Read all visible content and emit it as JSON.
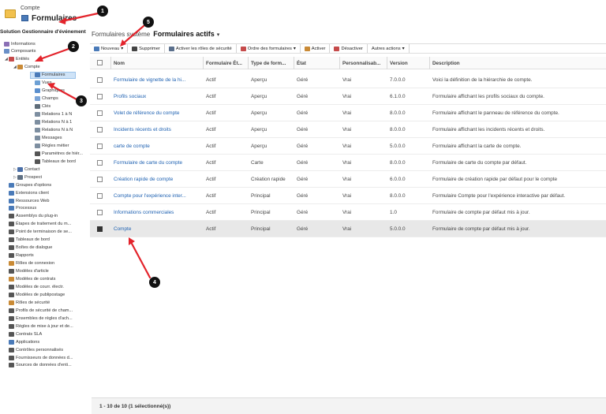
{
  "header": {
    "small_label": "Compte",
    "title": "Formulaires",
    "solution": "Solution Gestionnaire d'événement"
  },
  "tree": [
    {
      "label": "Informations",
      "icon": "puzzle-icon",
      "color": "#8a6fb5",
      "indent": 0,
      "toggle": ""
    },
    {
      "label": "Composants",
      "icon": "grid-icon",
      "color": "#6a8fc7",
      "indent": 0,
      "toggle": ""
    },
    {
      "label": "Entités",
      "icon": "table-icon",
      "color": "#c54a4a",
      "indent": 1,
      "toggle": "◢"
    },
    {
      "label": "Compte",
      "icon": "account-icon",
      "color": "#c98a36",
      "indent": 2,
      "toggle": "◢"
    },
    {
      "label": "Formulaires",
      "icon": "form-icon",
      "color": "#4a7ab8",
      "indent": 3,
      "toggle": "",
      "selected": true
    },
    {
      "label": "Vues",
      "icon": "view-icon",
      "color": "#6da0d4",
      "indent": 3,
      "toggle": ""
    },
    {
      "label": "Graphiques",
      "icon": "chart-icon",
      "color": "#5b8fce",
      "indent": 3,
      "toggle": ""
    },
    {
      "label": "Champs",
      "icon": "field-icon",
      "color": "#7aa3d6",
      "indent": 3,
      "toggle": ""
    },
    {
      "label": "Clés",
      "icon": "key-icon",
      "color": "#5f6d7a",
      "indent": 3,
      "toggle": ""
    },
    {
      "label": "Relations 1 à N",
      "icon": "relation-icon",
      "color": "#7d8ea0",
      "indent": 3,
      "toggle": ""
    },
    {
      "label": "Relations N à 1",
      "icon": "relation-icon",
      "color": "#7d8ea0",
      "indent": 3,
      "toggle": ""
    },
    {
      "label": "Relations N à N",
      "icon": "relation-icon",
      "color": "#7d8ea0",
      "indent": 3,
      "toggle": ""
    },
    {
      "label": "Messages",
      "icon": "message-icon",
      "color": "#7d8ea0",
      "indent": 3,
      "toggle": ""
    },
    {
      "label": "Règles métier",
      "icon": "rule-icon",
      "color": "#7d8ea0",
      "indent": 3,
      "toggle": ""
    },
    {
      "label": "Paramètres de hiér...",
      "icon": "hierarchy-icon",
      "color": "#555",
      "indent": 3,
      "toggle": ""
    },
    {
      "label": "Tableaux de bord",
      "icon": "dashboard-icon",
      "color": "#555",
      "indent": 3,
      "toggle": ""
    },
    {
      "label": "Contact",
      "icon": "contact-icon",
      "color": "#4a6fa8",
      "indent": 2,
      "toggle": "▷"
    },
    {
      "label": "Prospect",
      "icon": "prospect-icon",
      "color": "#5e6f82",
      "indent": 2,
      "toggle": "▷"
    },
    {
      "label": "Groupes d'options",
      "icon": "options-icon",
      "color": "#4a7ab8",
      "indent": 1,
      "toggle": ""
    },
    {
      "label": "Extensions client",
      "icon": "extension-icon",
      "color": "#4a7ab8",
      "indent": 1,
      "toggle": ""
    },
    {
      "label": "Ressources Web",
      "icon": "web-icon",
      "color": "#4a7ab8",
      "indent": 1,
      "toggle": ""
    },
    {
      "label": "Processus",
      "icon": "process-icon",
      "color": "#4a7ab8",
      "indent": 1,
      "toggle": ""
    },
    {
      "label": "Assemblys du plug-in",
      "icon": "plugin-icon",
      "color": "#555",
      "indent": 1,
      "toggle": ""
    },
    {
      "label": "Étapes de traitement du m...",
      "icon": "step-icon",
      "color": "#555",
      "indent": 1,
      "toggle": ""
    },
    {
      "label": "Point de terminaison de se...",
      "icon": "endpoint-icon",
      "color": "#555",
      "indent": 1,
      "toggle": ""
    },
    {
      "label": "Tableaux de bord",
      "icon": "dashboard-icon",
      "color": "#555",
      "indent": 1,
      "toggle": ""
    },
    {
      "label": "Boîtes de dialogue",
      "icon": "dialog-icon",
      "color": "#555",
      "indent": 1,
      "toggle": ""
    },
    {
      "label": "Rapports",
      "icon": "report-icon",
      "color": "#555",
      "indent": 1,
      "toggle": ""
    },
    {
      "label": "Rôles de connexion",
      "icon": "connection-icon",
      "color": "#c98a36",
      "indent": 1,
      "toggle": ""
    },
    {
      "label": "Modèles d'article",
      "icon": "article-icon",
      "color": "#555",
      "indent": 1,
      "toggle": ""
    },
    {
      "label": "Modèles de contrats",
      "icon": "contract-icon",
      "color": "#c98a36",
      "indent": 1,
      "toggle": ""
    },
    {
      "label": "Modèles de courr. électr.",
      "icon": "email-icon",
      "color": "#555",
      "indent": 1,
      "toggle": ""
    },
    {
      "label": "Modèles de publipostage",
      "icon": "mailmerge-icon",
      "color": "#555",
      "indent": 1,
      "toggle": ""
    },
    {
      "label": "Rôles de sécurité",
      "icon": "security-icon",
      "color": "#c98a36",
      "indent": 1,
      "toggle": ""
    },
    {
      "label": "Profils de sécurité de cham...",
      "icon": "profile-icon",
      "color": "#555",
      "indent": 1,
      "toggle": ""
    },
    {
      "label": "Ensembles de règles d'ach...",
      "icon": "ruleset-icon",
      "color": "#555",
      "indent": 1,
      "toggle": ""
    },
    {
      "label": "Règles de mise à jour et de...",
      "icon": "update-icon",
      "color": "#555",
      "indent": 1,
      "toggle": ""
    },
    {
      "label": "Contrats SLA",
      "icon": "sla-icon",
      "color": "#555",
      "indent": 1,
      "toggle": ""
    },
    {
      "label": "Applications",
      "icon": "app-icon",
      "color": "#4a7ab8",
      "indent": 1,
      "toggle": ""
    },
    {
      "label": "Contrôles personnalisés",
      "icon": "control-icon",
      "color": "#555",
      "indent": 1,
      "toggle": ""
    },
    {
      "label": "Fournisseurs de données d...",
      "icon": "provider-icon",
      "color": "#555",
      "indent": 1,
      "toggle": ""
    },
    {
      "label": "Sources de données d'enti...",
      "icon": "source-icon",
      "color": "#555",
      "indent": 1,
      "toggle": ""
    }
  ],
  "breadcrumb": {
    "prefix": "Formulaires système",
    "view": "Formulaires actifs",
    "dropdown": "▾"
  },
  "toolbar": [
    {
      "label": "Nouveau",
      "icon": "new-icon",
      "color": "#4a7ab8",
      "dropdown": "▾"
    },
    {
      "label": "Supprimer",
      "icon": "delete-icon",
      "color": "#444",
      "dropdown": ""
    },
    {
      "label": "Activer les rôles de sécurité",
      "icon": "roles-icon",
      "color": "#5a6f8c",
      "dropdown": ""
    },
    {
      "label": "Ordre des formulaires",
      "icon": "order-icon",
      "color": "#c54a4a",
      "dropdown": "▾"
    },
    {
      "label": "Activer",
      "icon": "activate-icon",
      "color": "#c98a36",
      "dropdown": ""
    },
    {
      "label": "Désactiver",
      "icon": "deactivate-icon",
      "color": "#c54a4a",
      "dropdown": ""
    },
    {
      "label": "Autres actions",
      "icon": "",
      "color": "",
      "dropdown": "▾"
    }
  ],
  "columns": [
    "Nom",
    "Formulaire Ét...",
    "Type de form...",
    "État",
    "Personnalisab...",
    "Version",
    "Description"
  ],
  "rows": [
    {
      "name": "Formulaire de vignette de la hi...",
      "status": "Actif",
      "type": "Aperçu",
      "state": "Géré",
      "custom": "Vrai",
      "version": "7.0.0.0",
      "desc": "Voici la définition de la hiérarchie de compte.",
      "selected": false
    },
    {
      "name": "Profils sociaux",
      "status": "Actif",
      "type": "Aperçu",
      "state": "Géré",
      "custom": "Vrai",
      "version": "6.1.0.0",
      "desc": "Formulaire affichant les profils sociaux du compte.",
      "selected": false
    },
    {
      "name": "Volet de référence du compte",
      "status": "Actif",
      "type": "Aperçu",
      "state": "Géré",
      "custom": "Vrai",
      "version": "8.0.0.0",
      "desc": "Formulaire affichant le panneau de référence du compte.",
      "selected": false
    },
    {
      "name": "Incidents récents et droits",
      "status": "Actif",
      "type": "Aperçu",
      "state": "Géré",
      "custom": "Vrai",
      "version": "8.0.0.0",
      "desc": "Formulaire affichant les incidents récents et droits.",
      "selected": false
    },
    {
      "name": "carte de compte",
      "status": "Actif",
      "type": "Aperçu",
      "state": "Géré",
      "custom": "Vrai",
      "version": "5.0.0.0",
      "desc": "Formulaire affichant la carte de compte.",
      "selected": false
    },
    {
      "name": "Formulaire de carte du compte",
      "status": "Actif",
      "type": "Carte",
      "state": "Géré",
      "custom": "Vrai",
      "version": "8.0.0.0",
      "desc": "Formulaire de carte du compte par défaut.",
      "selected": false
    },
    {
      "name": "Création rapide de compte",
      "status": "Actif",
      "type": "Création rapide",
      "state": "Géré",
      "custom": "Vrai",
      "version": "6.0.0.0",
      "desc": "Formulaire de création rapide par défaut pour le compte",
      "selected": false
    },
    {
      "name": "Compte pour l'expérience inter...",
      "status": "Actif",
      "type": "Principal",
      "state": "Géré",
      "custom": "Vrai",
      "version": "8.0.0.0",
      "desc": "Formulaire Compte pour l'expérience interactive par défaut.",
      "selected": false
    },
    {
      "name": "Informations commerciales",
      "status": "Actif",
      "type": "Principal",
      "state": "Géré",
      "custom": "Vrai",
      "version": "1.0",
      "desc": "Formulaire de compte par défaut mis à jour.",
      "selected": false
    },
    {
      "name": "Compte",
      "status": "Actif",
      "type": "Principal",
      "state": "Géré",
      "custom": "Vrai",
      "version": "5.0.0.0",
      "desc": "Formulaire de compte par défaut mis à jour.",
      "selected": true
    }
  ],
  "footer": "1 - 10 de 10 (1 sélectionné(s))",
  "markers": [
    "1",
    "2",
    "3",
    "4",
    "5"
  ],
  "colors": {
    "arrow": "#e3232b",
    "link": "#1f62b2",
    "selection": "#cfe3f7"
  }
}
